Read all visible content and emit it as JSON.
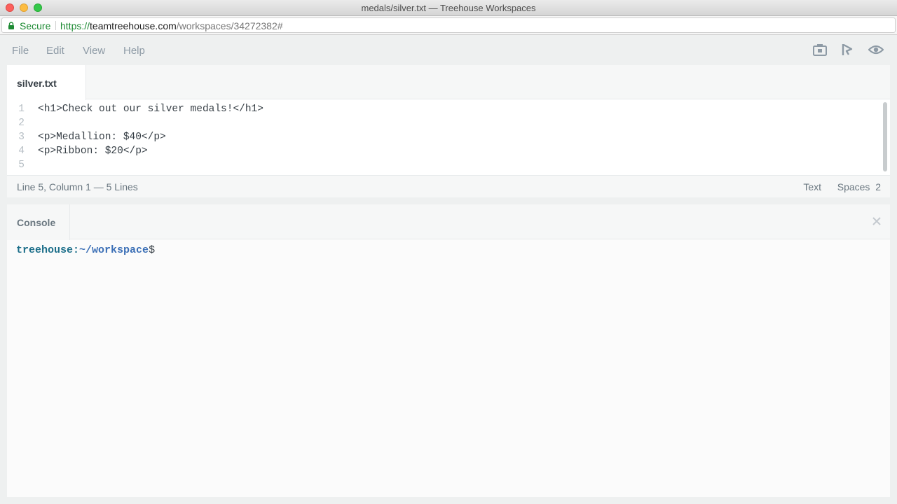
{
  "window": {
    "title": "medals/silver.txt — Treehouse Workspaces"
  },
  "address_bar": {
    "secure_label": "Secure",
    "url_scheme": "https://",
    "url_host": "teamtreehouse.com",
    "url_path": "/workspaces/34272382#"
  },
  "menu": {
    "items": [
      "File",
      "Edit",
      "View",
      "Help"
    ],
    "tool_icons": [
      "screenshot-icon",
      "share-icon",
      "preview-eye-icon"
    ]
  },
  "editor": {
    "tab_label": "silver.txt",
    "lines": [
      {
        "number": "1",
        "text": "<h1>Check out our silver medals!</h1>"
      },
      {
        "number": "2",
        "text": ""
      },
      {
        "number": "3",
        "text": "<p>Medallion: $40</p>"
      },
      {
        "number": "4",
        "text": "<p>Ribbon: $20</p>"
      },
      {
        "number": "5",
        "text": ""
      }
    ],
    "status": {
      "position": "Line 5, Column 1 — 5 Lines",
      "mode": "Text",
      "indent": "Spaces  2"
    }
  },
  "console": {
    "label": "Console",
    "prompt_host": "treehouse",
    "prompt_sep": ":",
    "prompt_path": "~/workspace",
    "prompt_dollar": "$"
  },
  "colors": {
    "secure_green": "#1d8a33",
    "prompt_host": "#1d6f8a",
    "prompt_path": "#3b6fb6"
  }
}
